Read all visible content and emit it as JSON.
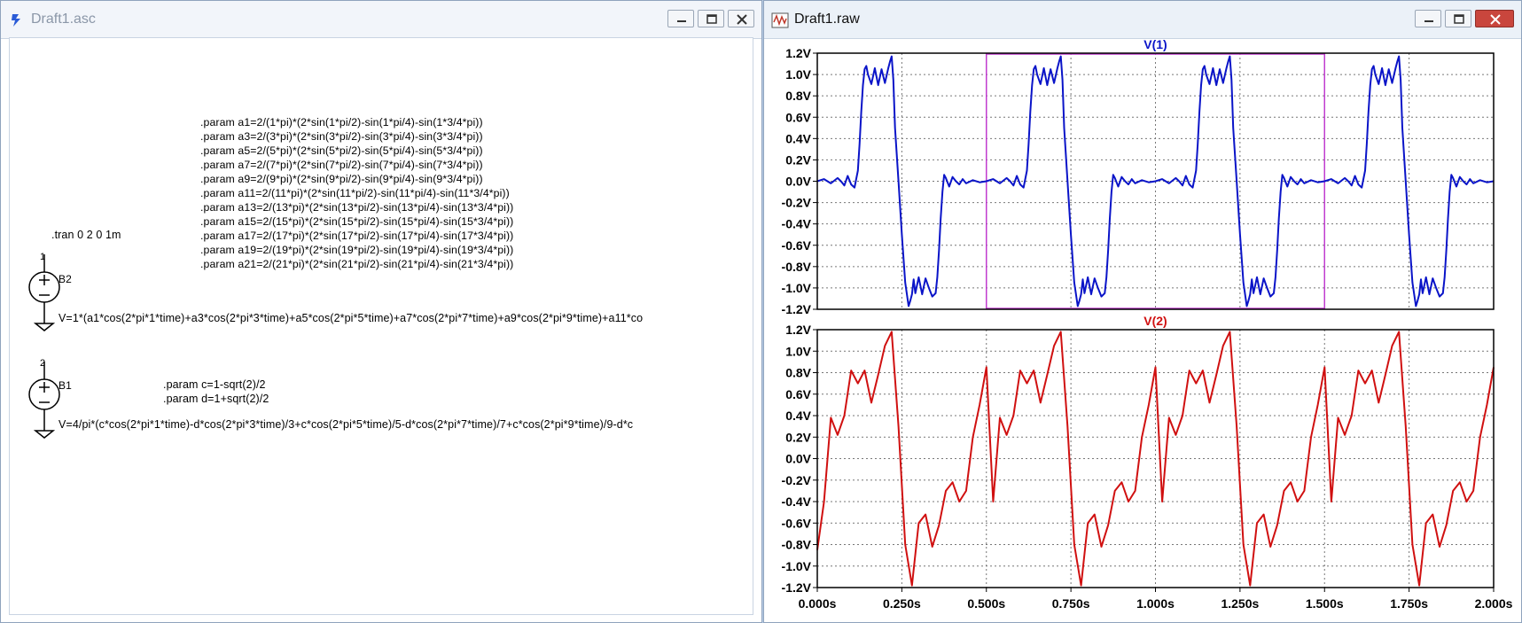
{
  "schematic_window": {
    "title": "Draft1.asc",
    "directive_tran": ".tran 0 2 0 1m",
    "params_a": [
      ".param a1=2/(1*pi)*(2*sin(1*pi/2)-sin(1*pi/4)-sin(1*3/4*pi))",
      ".param a3=2/(3*pi)*(2*sin(3*pi/2)-sin(3*pi/4)-sin(3*3/4*pi))",
      ".param a5=2/(5*pi)*(2*sin(5*pi/2)-sin(5*pi/4)-sin(5*3/4*pi))",
      ".param a7=2/(7*pi)*(2*sin(7*pi/2)-sin(7*pi/4)-sin(7*3/4*pi))",
      ".param a9=2/(9*pi)*(2*sin(9*pi/2)-sin(9*pi/4)-sin(9*3/4*pi))",
      ".param a11=2/(11*pi)*(2*sin(11*pi/2)-sin(11*pi/4)-sin(11*3/4*pi))",
      ".param a13=2/(13*pi)*(2*sin(13*pi/2)-sin(13*pi/4)-sin(13*3/4*pi))",
      ".param a15=2/(15*pi)*(2*sin(15*pi/2)-sin(15*pi/4)-sin(15*3/4*pi))",
      ".param a17=2/(17*pi)*(2*sin(17*pi/2)-sin(17*pi/4)-sin(17*3/4*pi))",
      ".param a19=2/(19*pi)*(2*sin(19*pi/2)-sin(19*pi/4)-sin(19*3/4*pi))",
      ".param a21=2/(21*pi)*(2*sin(21*pi/2)-sin(21*pi/4)-sin(21*3/4*pi))"
    ],
    "b2": {
      "net": "1",
      "name": "B2",
      "expr": "V=1*(a1*cos(2*pi*1*time)+a3*cos(2*pi*3*time)+a5*cos(2*pi*5*time)+a7*cos(2*pi*7*time)+a9*cos(2*pi*9*time)+a11*co"
    },
    "b1": {
      "net": "2",
      "name": "B1",
      "param_c": ".param c=1-sqrt(2)/2",
      "param_d": ".param d=1+sqrt(2)/2",
      "expr": "V=4/pi*(c*cos(2*pi*1*time)-d*cos(2*pi*3*time)/3+c*cos(2*pi*5*time)/5-d*cos(2*pi*7*time)/7+c*cos(2*pi*9*time)/9-d*c"
    }
  },
  "waveform_window": {
    "title": "Draft1.raw"
  },
  "chart_data": [
    {
      "type": "line",
      "title": "V(1)",
      "color": "#0a14c8",
      "xlim": [
        0,
        2
      ],
      "ylim": [
        -1.2,
        1.2
      ],
      "yticks": [
        "1.2V",
        "1.0V",
        "0.8V",
        "0.6V",
        "0.4V",
        "0.2V",
        "0.0V",
        "-0.2V",
        "-0.4V",
        "-0.6V",
        "-0.8V",
        "-1.0V",
        "-1.2V"
      ],
      "cursor_x": [
        0.5,
        1.5
      ],
      "cursor_color": "#c03ccf",
      "grid": true,
      "x": [
        0,
        0.02,
        0.04,
        0.06,
        0.07,
        0.08,
        0.09,
        0.1,
        0.11,
        0.12,
        0.125,
        0.13,
        0.135,
        0.14,
        0.145,
        0.15,
        0.16,
        0.17,
        0.18,
        0.19,
        0.2,
        0.21,
        0.215,
        0.22,
        0.225,
        0.23,
        0.24,
        0.25,
        0.26,
        0.27,
        0.275,
        0.28,
        0.285,
        0.29,
        0.3,
        0.31,
        0.32,
        0.33,
        0.34,
        0.35,
        0.355,
        0.36,
        0.365,
        0.37,
        0.375,
        0.38,
        0.39,
        0.4,
        0.41,
        0.42,
        0.43,
        0.44,
        0.46,
        0.48,
        0.5
      ],
      "series": [
        {
          "values": [
            0,
            0.02,
            -0.02,
            0.03,
            0.0,
            -0.04,
            0.05,
            -0.03,
            -0.06,
            0.1,
            0.35,
            0.65,
            0.9,
            1.05,
            1.08,
            1.0,
            0.91,
            1.06,
            0.9,
            1.05,
            0.92,
            1.06,
            1.12,
            1.17,
            0.95,
            0.5,
            0.0,
            -0.5,
            -0.95,
            -1.17,
            -1.12,
            -1.06,
            -0.92,
            -1.05,
            -0.9,
            -1.06,
            -0.91,
            -1.0,
            -1.08,
            -1.05,
            -0.9,
            -0.65,
            -0.35,
            -0.1,
            0.06,
            0.03,
            -0.05,
            0.04,
            0.0,
            -0.03,
            0.02,
            -0.02,
            0.01,
            -0.01,
            0
          ]
        }
      ]
    },
    {
      "type": "line",
      "title": "V(2)",
      "color": "#d01010",
      "xlim": [
        0,
        2
      ],
      "ylim": [
        -1.2,
        1.2
      ],
      "yticks": [
        "1.2V",
        "1.0V",
        "0.8V",
        "0.6V",
        "0.4V",
        "0.2V",
        "0.0V",
        "-0.2V",
        "-0.4V",
        "-0.6V",
        "-0.8V",
        "-1.0V",
        "-1.2V"
      ],
      "grid": true,
      "x": [
        0,
        0.02,
        0.04,
        0.06,
        0.08,
        0.1,
        0.12,
        0.14,
        0.16,
        0.18,
        0.2,
        0.22,
        0.24,
        0.26,
        0.28,
        0.3,
        0.32,
        0.34,
        0.36,
        0.38,
        0.4,
        0.42,
        0.44,
        0.46,
        0.48,
        0.5
      ],
      "series": [
        {
          "values": [
            -0.85,
            -0.4,
            0.38,
            0.22,
            0.4,
            0.82,
            0.7,
            0.82,
            0.52,
            0.78,
            1.05,
            1.18,
            0.3,
            -0.8,
            -1.18,
            -0.6,
            -0.52,
            -0.82,
            -0.62,
            -0.3,
            -0.22,
            -0.4,
            -0.3,
            0.2,
            0.5,
            0.85
          ]
        }
      ]
    }
  ],
  "x_ticks": [
    "0.000s",
    "0.250s",
    "0.500s",
    "0.750s",
    "1.000s",
    "1.250s",
    "1.500s",
    "1.750s",
    "2.000s"
  ]
}
